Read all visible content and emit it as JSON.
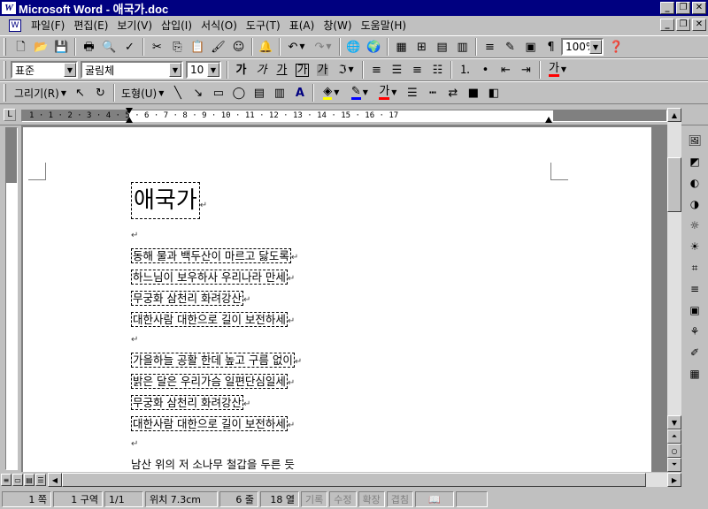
{
  "window": {
    "title": "Microsoft Word - 애국가.doc",
    "app_icon": "W"
  },
  "menu": [
    "파일(F)",
    "편집(E)",
    "보기(V)",
    "삽입(I)",
    "서식(O)",
    "도구(T)",
    "표(A)",
    "창(W)",
    "도움말(H)"
  ],
  "standard_toolbar": {
    "zoom": "100%"
  },
  "formatting_toolbar": {
    "style": "표준",
    "font": "굴림체",
    "size": "10",
    "bold": "가",
    "italic": "가",
    "underline": "가",
    "char_border": "가",
    "char_shading": "가",
    "font_color": "가"
  },
  "drawing_toolbar": {
    "draw_label": "그리기(R)",
    "shapes_label": "도형(U)",
    "font_color": "가"
  },
  "ruler": {
    "ticks": "1 · 1 · 2 · 3 · 4 · 5 · 6 · 7 · 8 · 9 · 10 · 11 · 12 · 13 · 14 · 15 · 16 · 17"
  },
  "document": {
    "title": "애국가",
    "paragraph_mark": "↵",
    "stanza1": [
      "동해 물과 백두산이 마르고 닳도록",
      "하느님이 보우하사 우리나라 만세",
      "무궁화 삼천리 화려강산",
      "대한사람 대한으로 길이 보전하세"
    ],
    "stanza2": [
      "가을하늘 공활 한데 높고 구름 없이",
      "밝은 달은 우리가슴 일편단심일세",
      "무궁화 삼천리 화려강산",
      "대한사람 대한으로 길이 보전하세"
    ],
    "partial_line": "남산 위의 저 소나무 철갑을 두른 듯"
  },
  "status": {
    "page": "1 쪽",
    "section": "1 구역",
    "page_of": "1/1",
    "position": "위치 7.3cm",
    "line": "6 줄",
    "column": "18 열",
    "rec": "기록",
    "trk": "수정",
    "ext": "확장",
    "ovr": "겹침"
  }
}
